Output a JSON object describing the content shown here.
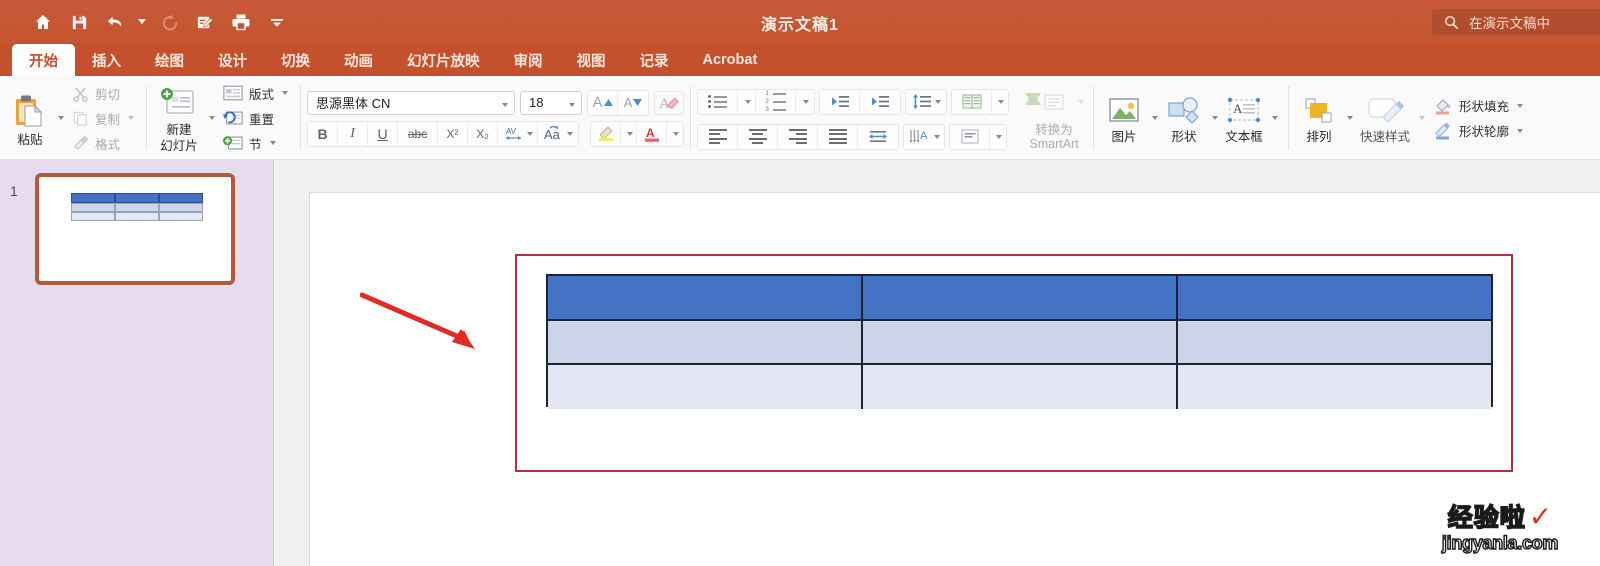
{
  "titlebar": {
    "document_title": "演示文稿1",
    "quick_access": [
      {
        "name": "home-icon",
        "label": "主页"
      },
      {
        "name": "save-icon",
        "label": "保存"
      },
      {
        "name": "undo-icon",
        "label": "撤消"
      },
      {
        "name": "redo-icon",
        "label": "恢复"
      },
      {
        "name": "edit-icon",
        "label": "编辑"
      },
      {
        "name": "print-icon",
        "label": "打印"
      },
      {
        "name": "overflow-icon",
        "label": "更多"
      }
    ],
    "search": {
      "icon": "search-icon",
      "placeholder": "在演示文稿中",
      "label": "在演示文稿中"
    },
    "accent_color": "#c4552f"
  },
  "tabs": [
    {
      "label": "开始",
      "active": true
    },
    {
      "label": "插入",
      "active": false
    },
    {
      "label": "绘图",
      "active": false
    },
    {
      "label": "设计",
      "active": false
    },
    {
      "label": "切换",
      "active": false
    },
    {
      "label": "动画",
      "active": false
    },
    {
      "label": "幻灯片放映",
      "active": false
    },
    {
      "label": "审阅",
      "active": false
    },
    {
      "label": "视图",
      "active": false
    },
    {
      "label": "记录",
      "active": false
    },
    {
      "label": "Acrobat",
      "active": false
    }
  ],
  "ribbon": {
    "clipboard": {
      "paste_label": "粘贴",
      "cut_label": "剪切",
      "copy_label": "复制",
      "format_label": "格式"
    },
    "slides": {
      "new_slide_label_line1": "新建",
      "new_slide_label_line2": "幻灯片",
      "layout_label": "版式",
      "reset_label": "重置",
      "section_label": "节"
    },
    "font": {
      "font_name": "思源黑体 CN",
      "font_size": "18",
      "grow_font": "A",
      "shrink_font": "A",
      "clear_format": "A",
      "bold": "B",
      "italic": "I",
      "underline": "U",
      "strikethrough": "abc",
      "superscript": "X²",
      "subscript": "X₂",
      "char_spacing": "AV",
      "change_case": "Aa",
      "highlight": "",
      "font_color": "A"
    },
    "paragraph": {
      "bullets": "",
      "numbering": "",
      "decrease_indent": "",
      "increase_indent": "",
      "line_spacing": "",
      "columns": "",
      "align_left": "",
      "align_center": "",
      "align_right": "",
      "justify": "",
      "align_text": "",
      "text_direction": "",
      "text_align_vertical": "",
      "convert_smartart_line1": "转换为",
      "convert_smartart_line2": "SmartArt"
    },
    "drawing": {
      "picture_label": "图片",
      "shapes_label": "形状",
      "textbox_label": "文本框",
      "arrange_label": "排列",
      "quick_styles_label": "快速样式",
      "shape_fill_label": "形状填充",
      "shape_outline_label": "形状轮廓"
    }
  },
  "slide_panel": {
    "background_color": "#e6dcee",
    "slides": [
      {
        "number": "1",
        "selected": true
      }
    ]
  },
  "slide": {
    "placeholder_border_color": "#b4303b",
    "table": {
      "columns": 3,
      "rows": 3,
      "header_fill": "#4472c4",
      "band1_fill": "#ccd4e9",
      "band2_fill": "#e3e7f4",
      "border_color": "#1f2430",
      "cells": [
        [
          "",
          "",
          ""
        ],
        [
          "",
          "",
          ""
        ],
        [
          "",
          "",
          ""
        ]
      ]
    },
    "annotation": {
      "type": "arrow",
      "color": "#e02b26",
      "direction": "down-right"
    }
  },
  "watermark": {
    "cn_text": "经验啦",
    "check": "✓",
    "url": "jingyanla.com"
  }
}
